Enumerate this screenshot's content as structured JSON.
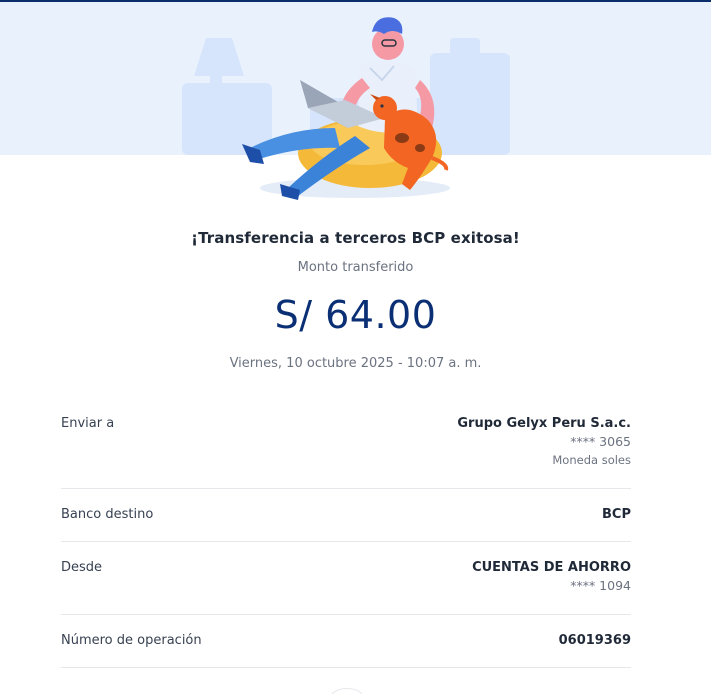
{
  "receipt": {
    "title": "¡Transferencia a terceros BCP exitosa!",
    "subtitle": "Monto transferido",
    "amount": "S/ 64.00",
    "datetime": "Viernes, 10 octubre 2025 - 10:07 a. m."
  },
  "details": {
    "recipient": {
      "label": "Enviar a",
      "name": "Grupo Gelyx Peru S.a.c.",
      "account": "**** 3065",
      "currency": "Moneda soles"
    },
    "bank": {
      "label": "Banco destino",
      "value": "BCP"
    },
    "source": {
      "label": "Desde",
      "account_type": "CUENTAS DE AHORRO",
      "account": "**** 1094"
    },
    "operation": {
      "label": "Número de operación",
      "value": "06019369"
    }
  },
  "colors": {
    "brand_dark": "#0b2d6b",
    "amount": "#0b2f75",
    "hero_background": "#e9f1fd",
    "accent_orange": "#f26522"
  },
  "icons": [
    "success-illustration"
  ]
}
